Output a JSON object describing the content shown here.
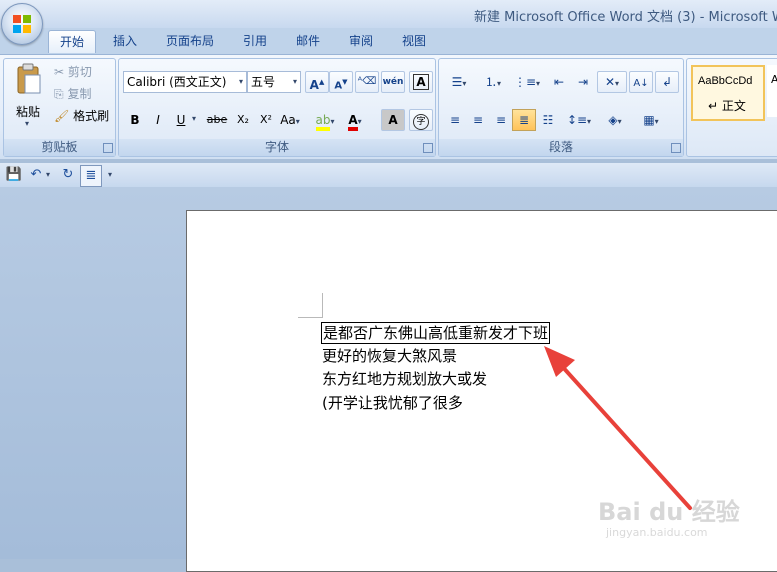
{
  "window": {
    "title": "新建 Microsoft Office Word 文档 (3) - Microsoft W"
  },
  "tabs": [
    {
      "label": "开始",
      "active": true
    },
    {
      "label": "插入"
    },
    {
      "label": "页面布局"
    },
    {
      "label": "引用"
    },
    {
      "label": "邮件"
    },
    {
      "label": "审阅"
    },
    {
      "label": "视图"
    }
  ],
  "clipboard": {
    "paste_label": "粘贴",
    "cut_label": "剪切",
    "copy_label": "复制",
    "format_painter_label": "格式刷",
    "group_label": "剪贴板"
  },
  "font": {
    "font_name": "Calibri (西文正文)",
    "font_size": "五号",
    "group_label": "字体",
    "bold": "B",
    "italic": "I",
    "underline": "U",
    "strike": "abe",
    "subscript": "X₂",
    "superscript": "X²",
    "change_case": "Aa",
    "grow": "A",
    "shrink": "A",
    "phonetic": "wén",
    "font_color_letter": "A",
    "char_shading": "A",
    "enclose": "字"
  },
  "paragraph": {
    "group_label": "段落"
  },
  "styles": {
    "sample": "AaBbCcDd",
    "name": "↵ 正文",
    "sample2": "A"
  },
  "document": {
    "lines": [
      "是都否广东佛山高低重新发才下班",
      "更好的恢复大煞风景",
      "东方红地方规划放大或发",
      "(开学让我忧郁了很多"
    ]
  },
  "watermark": {
    "main": "Bai du 经验",
    "sub": "jingyan.baidu.com"
  },
  "colors": {
    "accent": "#15428b",
    "font_color_bar": "#e00000",
    "highlight_bar": "#ffff00",
    "arrow": "#e8413a"
  }
}
